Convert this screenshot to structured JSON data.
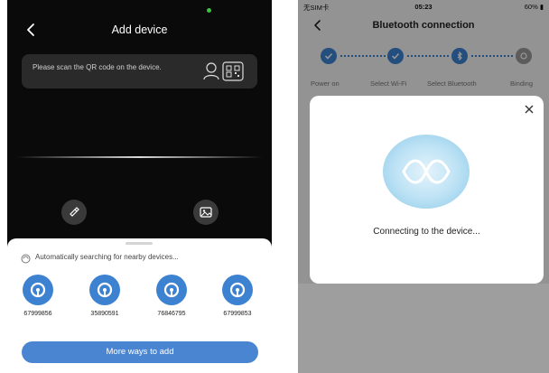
{
  "left": {
    "title": "Add device",
    "qr_hint": "Please scan the QR code on the device.",
    "search_text": "Automatically searching for nearby devices...",
    "devices": [
      {
        "id": "67999856"
      },
      {
        "id": "35890591"
      },
      {
        "id": "76846795"
      },
      {
        "id": "67999853"
      }
    ],
    "more_button": "More ways to add",
    "icons": [
      "back-arrow-icon",
      "person-icon",
      "qr-code-icon",
      "flashlight-icon",
      "image-icon",
      "searching-icon",
      "device-icon"
    ]
  },
  "right": {
    "status": {
      "carrier": "无SIM卡",
      "time": "05:23",
      "battery": "60%"
    },
    "title": "Bluetooth connection",
    "steps": [
      {
        "label": "Power on",
        "state": "done"
      },
      {
        "label": "Select Wi-Fi",
        "state": "done"
      },
      {
        "label": "Select Bluetooth",
        "state": "active"
      },
      {
        "label": "Binding",
        "state": "pending"
      }
    ],
    "dialog": {
      "message": "Connecting to the device..."
    },
    "colors": {
      "accent": "#3d82d1",
      "overlay": "rgba(0,0,0,0.40)"
    }
  }
}
